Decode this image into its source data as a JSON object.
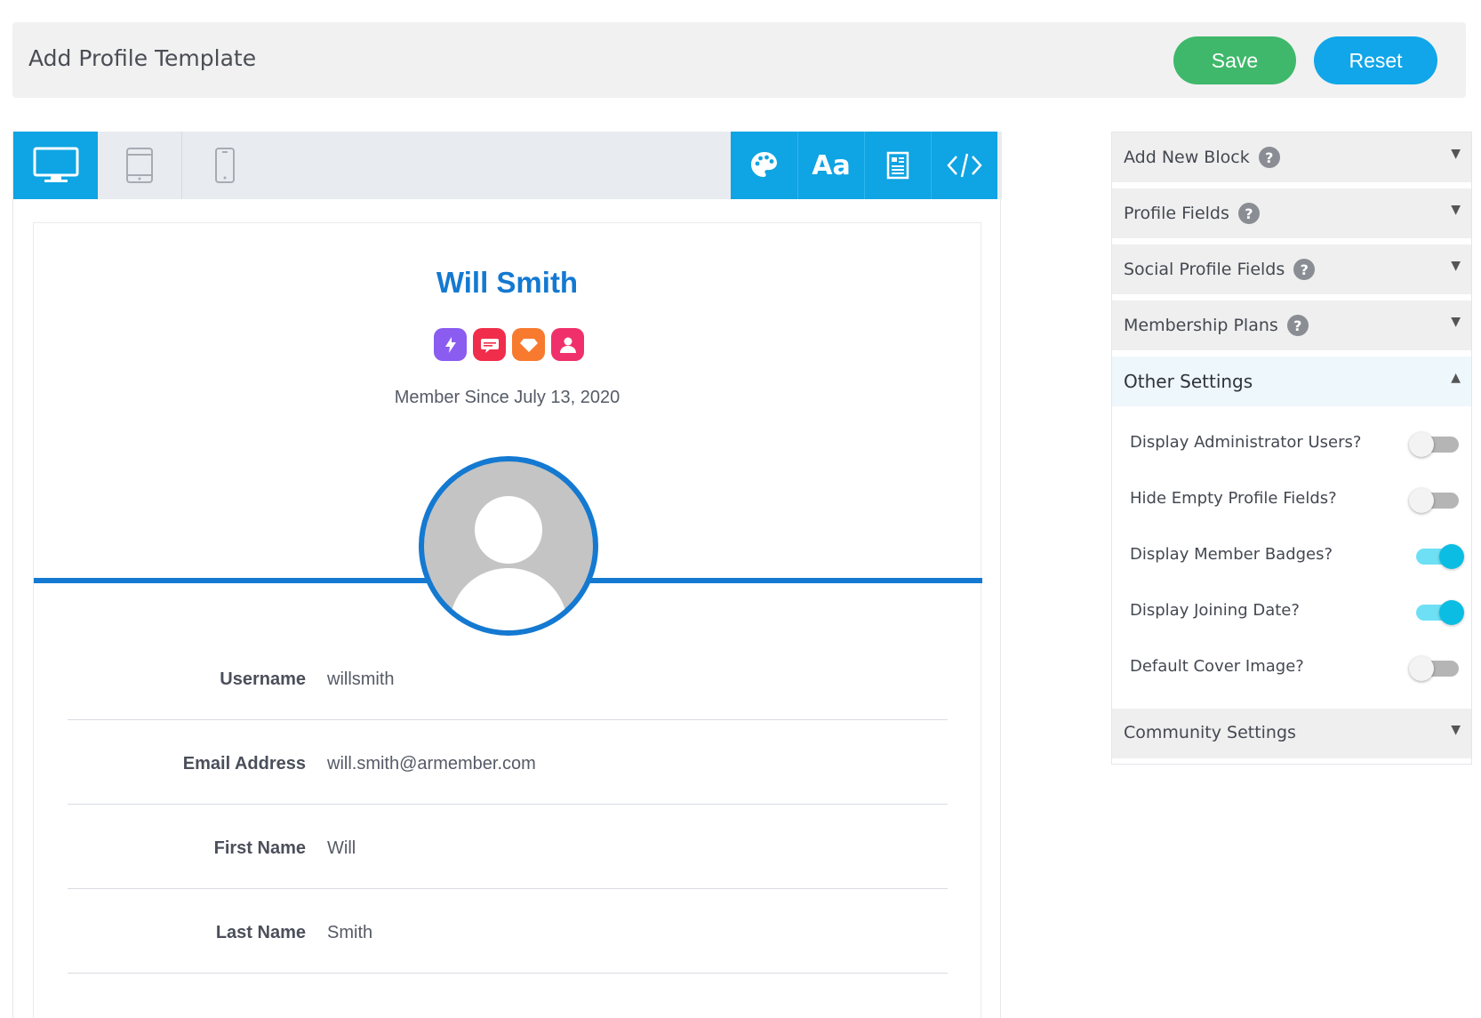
{
  "header": {
    "title": "Add Profile Template",
    "save_label": "Save",
    "reset_label": "Reset"
  },
  "toolbar": {
    "devices": [
      {
        "icon": "desktop-icon",
        "active": true
      },
      {
        "icon": "tablet-icon",
        "active": false
      },
      {
        "icon": "mobile-icon",
        "active": false
      }
    ],
    "tools": [
      {
        "icon": "palette-icon"
      },
      {
        "label": "Aa",
        "icon": "font-icon"
      },
      {
        "icon": "layout-icon"
      },
      {
        "icon": "code-icon"
      }
    ],
    "accent": "#0fa4e3"
  },
  "profile": {
    "name": "Will Smith",
    "member_since": "Member Since July 13, 2020",
    "badges": [
      {
        "icon": "bolt-badge-icon",
        "color": "#8a5cf0"
      },
      {
        "icon": "chat-badge-icon",
        "color": "#f02d4a"
      },
      {
        "icon": "diamond-badge-icon",
        "color": "#f77a2e"
      },
      {
        "icon": "user-badge-icon",
        "color": "#f0306a"
      }
    ],
    "fields": [
      {
        "label": "Username",
        "value": "willsmith"
      },
      {
        "label": "Email Address",
        "value": "will.smith@armember.com"
      },
      {
        "label": "First Name",
        "value": "Will"
      },
      {
        "label": "Last Name",
        "value": "Smith"
      }
    ],
    "accent": "#1479d1"
  },
  "sidebar": {
    "sections": [
      {
        "label": "Add New Block",
        "help": "?",
        "expanded": false
      },
      {
        "label": "Profile Fields",
        "help": "?",
        "expanded": false
      },
      {
        "label": "Social Profile Fields",
        "help": "?",
        "expanded": false
      },
      {
        "label": "Membership Plans",
        "help": "?",
        "expanded": false
      },
      {
        "label": "Other Settings",
        "expanded": true
      },
      {
        "label": "Community Settings",
        "expanded": false
      }
    ],
    "other_settings": [
      {
        "label": "Display Administrator Users?",
        "on": false
      },
      {
        "label": "Hide Empty Profile Fields?",
        "on": false
      },
      {
        "label": "Display Member Badges?",
        "on": true
      },
      {
        "label": "Display Joining Date?",
        "on": true
      },
      {
        "label": "Default Cover Image?",
        "on": false
      }
    ],
    "caret_down": "▼",
    "caret_up": "▲"
  }
}
